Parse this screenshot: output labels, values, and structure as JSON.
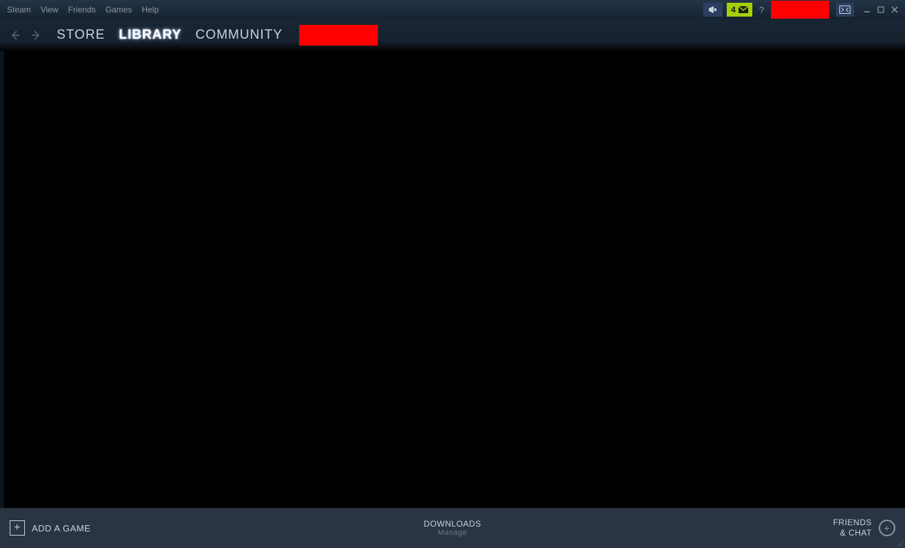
{
  "menubar": {
    "items": [
      "Steam",
      "View",
      "Friends",
      "Games",
      "Help"
    ],
    "inbox_count": "4",
    "help_symbol": "?"
  },
  "nav": {
    "tabs": [
      "STORE",
      "LIBRARY",
      "COMMUNITY"
    ],
    "active_index": 1
  },
  "bottom": {
    "add_game": "ADD A GAME",
    "downloads_title": "DOWNLOADS",
    "downloads_sub": "Manage",
    "friends_line1": "FRIENDS",
    "friends_line2": "& CHAT"
  }
}
